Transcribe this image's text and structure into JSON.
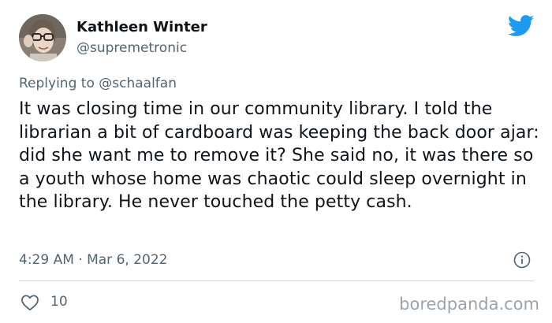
{
  "author": {
    "name": "Kathleen Winter",
    "handle": "@supremetronic"
  },
  "reply": {
    "prefix": "Replying to",
    "mention": "@schaalfan"
  },
  "tweet": {
    "text": "It was closing time in our community library. I told the librarian a bit of cardboard was keeping the back door ajar: did she want me to remove it? She said no, it was there so a youth whose home was chaotic could sleep overnight in the library. He never touched the petty cash.",
    "timestamp": "4:29 AM · Mar 6, 2022"
  },
  "actions": {
    "like_count": "10"
  },
  "watermark": "boredpanda.com",
  "icons": {
    "logo": "twitter-bird-icon",
    "info": "info-icon",
    "like": "heart-icon"
  },
  "colors": {
    "twitter_blue": "#1d9bf0",
    "text_primary": "#0f1419",
    "text_secondary": "#536471",
    "divider": "#cfd9de"
  }
}
